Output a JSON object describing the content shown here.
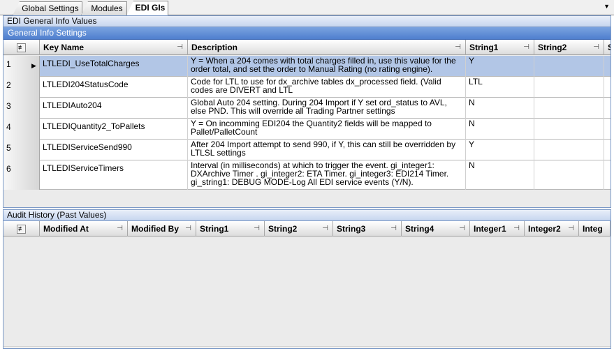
{
  "tabs": [
    {
      "label": "Global Settings"
    },
    {
      "label": "Modules"
    },
    {
      "label": "EDI GIs"
    }
  ],
  "active_tab": "EDI GIs",
  "top_pane": {
    "title": "EDI General Info Values",
    "group_title": "General Info Settings",
    "columns": [
      "Key Name",
      "Description",
      "String1",
      "String2",
      "S"
    ],
    "rows": [
      {
        "num": "1",
        "key": "LTLEDI_UseTotalCharges",
        "desc": "Y = When a 204 comes with total charges filled in, use this value for the order total, and set the order to Manual Rating (no rating engine).",
        "s1": "Y",
        "s2": ""
      },
      {
        "num": "2",
        "key": "LTLEDI204StatusCode",
        "desc": "Code for LTL to use for dx_archive tables dx_processed field. (Valid codes are DIVERT and LTL",
        "s1": "LTL",
        "s2": ""
      },
      {
        "num": "3",
        "key": "LTLEDIAuto204",
        "desc": "Global Auto 204 setting. During 204 Import if Y set ord_status to AVL, else PND. This will override all Trading Partner settings",
        "s1": "N",
        "s2": ""
      },
      {
        "num": "4",
        "key": "LTLEDIQuantity2_ToPallets",
        "desc": "Y = On incomming EDI204 the Quantity2 fields will be mapped to Pallet/PalletCount",
        "s1": "N",
        "s2": ""
      },
      {
        "num": "5",
        "key": "LTLEDIServiceSend990",
        "desc": "After 204 Import attempt to send 990, if Y, this can still be overridden by LTLSL settings",
        "s1": "Y",
        "s2": ""
      },
      {
        "num": "6",
        "key": "LTLEDIServiceTimers",
        "desc": "Interval (in milliseconds) at which to trigger the event. gi_integer1: DXArchive Timer . gi_integer2: ETA Timer. gi_integer3: EDI214 Timer. gi_string1: DEBUG MODE-Log All EDI service events (Y/N).",
        "s1": "N",
        "s2": ""
      }
    ]
  },
  "bottom_pane": {
    "title": "Audit History (Past Values)",
    "columns": [
      "Modified At",
      "Modified By",
      "String1",
      "String2",
      "String3",
      "String4",
      "Integer1",
      "Integer2",
      "Integ"
    ]
  },
  "icons": {
    "corner": "column-chooser-icon",
    "pin": "pin-icon",
    "dropdown": "chevron-down-icon",
    "row_indicator": "current-row-arrow-icon"
  },
  "colors": {
    "group_header": "#5b8bd6",
    "selected_row": "#b2c6e6",
    "pane_border": "#7b99c6"
  }
}
